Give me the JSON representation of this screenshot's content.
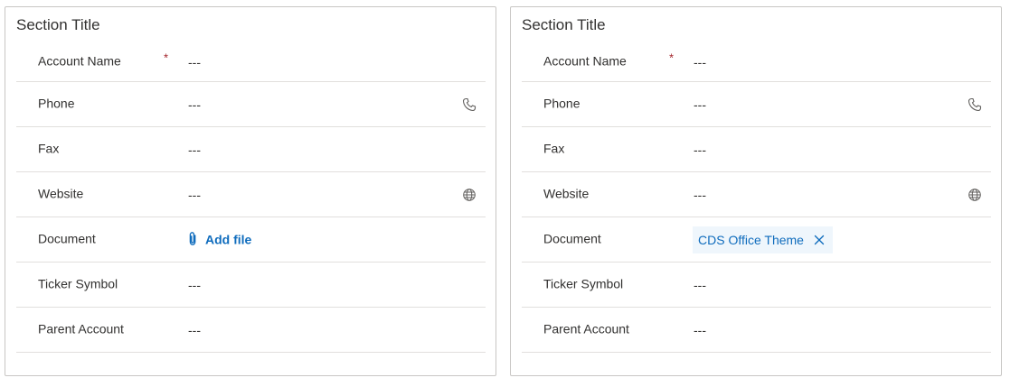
{
  "left_card": {
    "section_title": "Section Title",
    "fields": {
      "account_name": {
        "label": "Account Name",
        "required_mark": "*",
        "value": "---"
      },
      "phone": {
        "label": "Phone",
        "value": "---",
        "icon": "phone-icon"
      },
      "fax": {
        "label": "Fax",
        "value": "---"
      },
      "website": {
        "label": "Website",
        "value": "---",
        "icon": "globe-icon"
      },
      "document": {
        "label": "Document",
        "action_label": "Add file",
        "icon": "paperclip-icon"
      },
      "ticker_symbol": {
        "label": "Ticker Symbol",
        "value": "---"
      },
      "parent_account": {
        "label": "Parent Account",
        "value": "---"
      }
    }
  },
  "right_card": {
    "section_title": "Section Title",
    "fields": {
      "account_name": {
        "label": "Account Name",
        "required_mark": "*",
        "value": "---"
      },
      "phone": {
        "label": "Phone",
        "value": "---",
        "icon": "phone-icon"
      },
      "fax": {
        "label": "Fax",
        "value": "---"
      },
      "website": {
        "label": "Website",
        "value": "---",
        "icon": "globe-icon"
      },
      "document": {
        "label": "Document",
        "file_name": "CDS Office Theme",
        "icon": "close-icon"
      },
      "ticker_symbol": {
        "label": "Ticker Symbol",
        "value": "---"
      },
      "parent_account": {
        "label": "Parent Account",
        "value": "---"
      }
    }
  },
  "colors": {
    "accent": "#0f6cbd",
    "required": "#a4262c",
    "border": "#c8c6c4",
    "divider": "#e1dfdd",
    "chip_bg": "#eff6fc"
  }
}
